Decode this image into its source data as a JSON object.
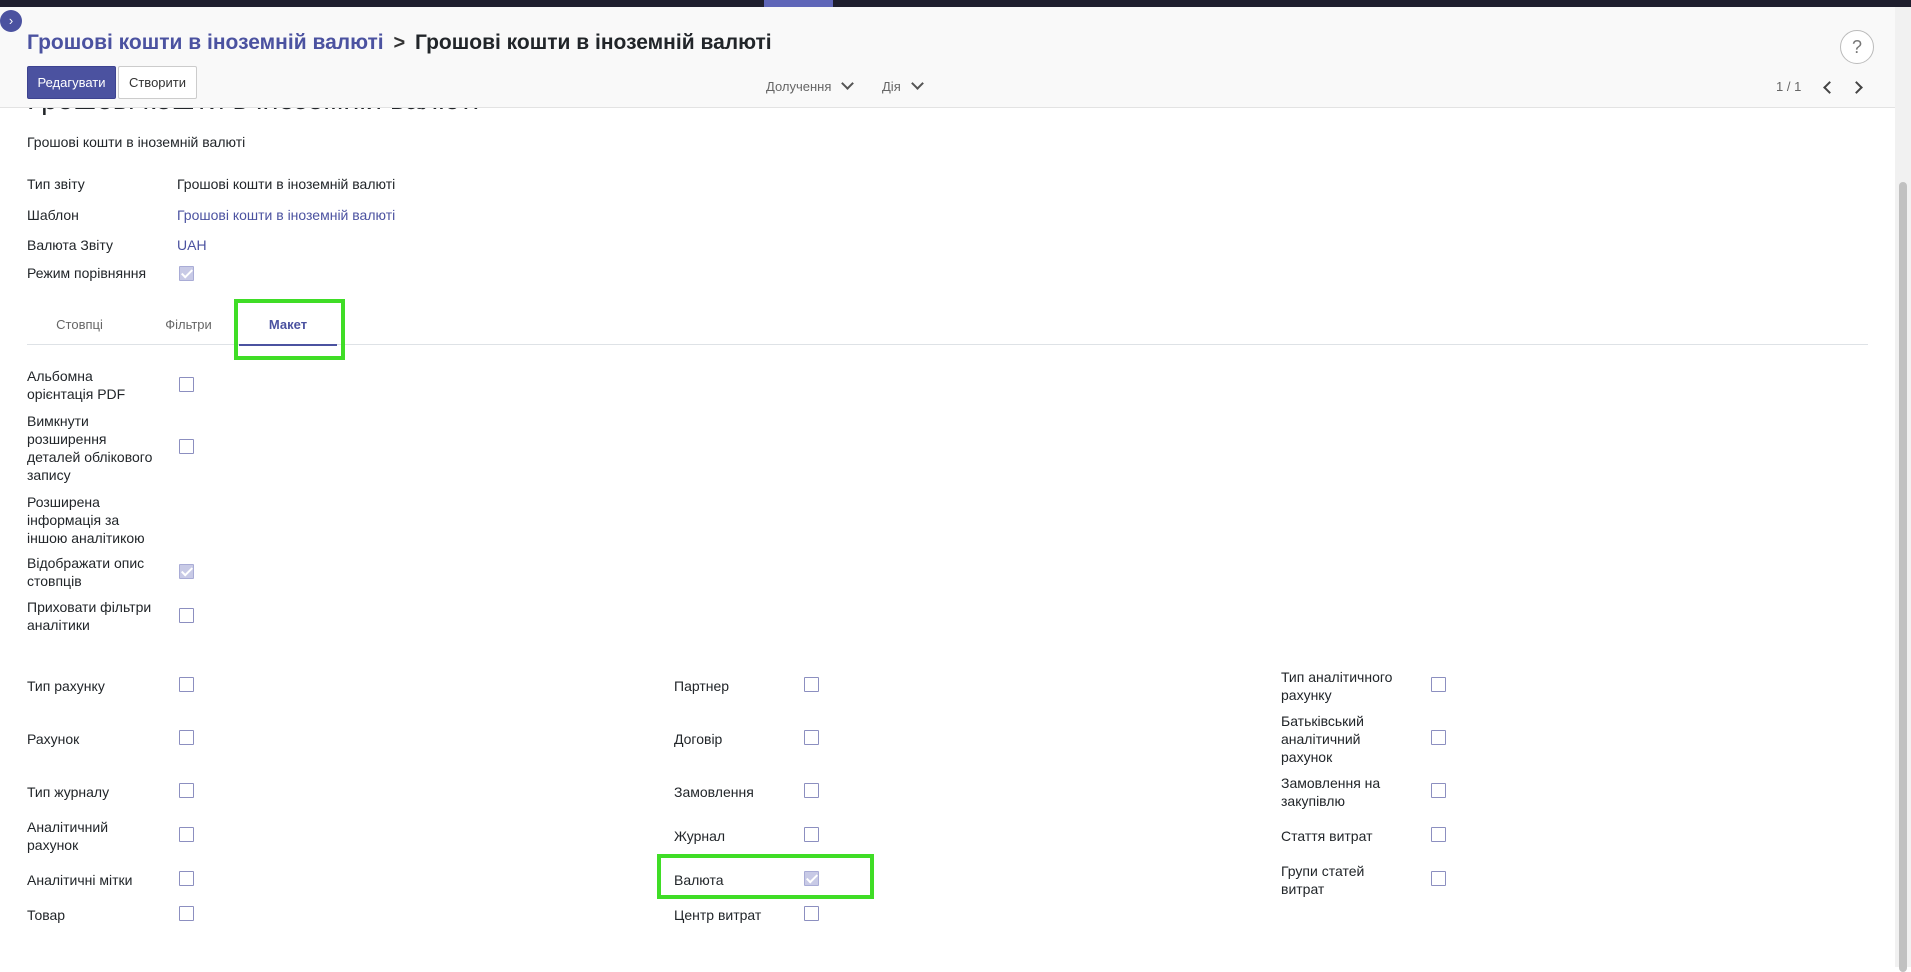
{
  "breadcrumb": {
    "parent": "Грошові кошти в іноземній валюті",
    "separator": ">",
    "current": "Грошові кошти в іноземній валюті"
  },
  "help_label": "?",
  "toggle_icon": "›",
  "buttons": {
    "edit": "Редагувати",
    "create": "Створити"
  },
  "dropdowns": {
    "attachment": "Долучення",
    "action": "Дія"
  },
  "pager": {
    "value": "1 / 1"
  },
  "form": {
    "title": "Грошові кошти в іноземній валюті",
    "subtitle": "Грошові кошти в іноземній валюті",
    "fields": {
      "report_type": {
        "label": "Тип звіту",
        "value": "Грошові кошти в іноземній валюті"
      },
      "template": {
        "label": "Шаблон",
        "value": "Грошові кошти в іноземній валюті"
      },
      "currency": {
        "label": "Валюта Звіту",
        "value": "UAH"
      },
      "comparison": {
        "label": "Режим порівняння",
        "checked": true
      }
    },
    "tabs": [
      "Стовпці",
      "Фільтри",
      "Макет"
    ],
    "active_tab": "Макет",
    "layout_options": [
      {
        "label": "Альбомна орієнтація PDF",
        "checked": false
      },
      {
        "label": "Вимкнути розширення деталей облікового запису",
        "checked": false
      },
      {
        "label": "Розширена інформація за іншою аналітикою",
        "checked": null
      },
      {
        "label": "Відображати опис стовпців",
        "checked": true
      },
      {
        "label": "Приховати фільтри аналітики",
        "checked": false
      }
    ],
    "grouping": {
      "col1": [
        {
          "label": "Тип рахунку",
          "checked": false
        },
        {
          "label": "Рахунок",
          "checked": false
        },
        {
          "label": "Тип журналу",
          "checked": false
        },
        {
          "label": "Аналітичний рахунок",
          "checked": false
        },
        {
          "label": "Аналітичні мітки",
          "checked": false
        },
        {
          "label": "Товар",
          "checked": false
        }
      ],
      "col2": [
        {
          "label": "Партнер",
          "checked": false
        },
        {
          "label": "Договір",
          "checked": false
        },
        {
          "label": "Замовлення",
          "checked": false
        },
        {
          "label": "Журнал",
          "checked": false
        },
        {
          "label": "Валюта",
          "checked": true
        },
        {
          "label": "Центр витрат",
          "checked": false
        }
      ],
      "col3": [
        {
          "label": "Тип аналітичного рахунку",
          "checked": false
        },
        {
          "label": "Батьківський аналітичний рахунок",
          "checked": false
        },
        {
          "label": "Замовлення на закупівлю",
          "checked": false
        },
        {
          "label": "Стаття витрат",
          "checked": false
        },
        {
          "label": "Групи статей витрат",
          "checked": false
        }
      ]
    }
  },
  "colors": {
    "accent": "#4b52a0",
    "highlight": "#3fdd26"
  }
}
